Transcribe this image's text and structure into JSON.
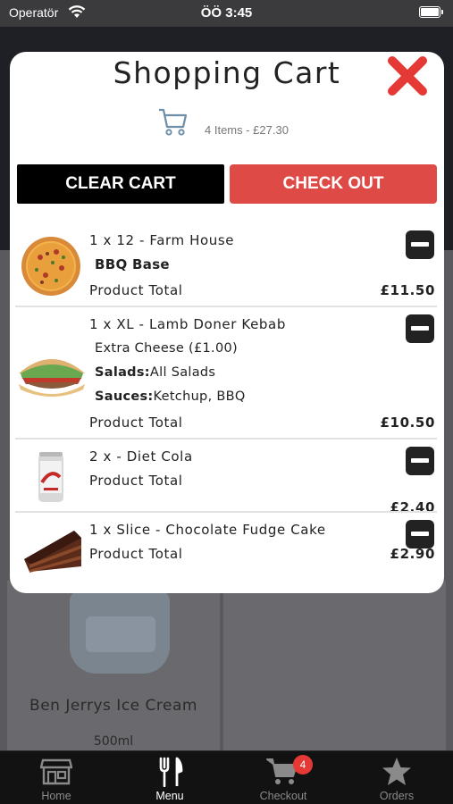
{
  "status_bar": {
    "carrier": "Operatör",
    "time": "ÖÖ 3:45"
  },
  "background": {
    "item_name": "Ben Jerrys Ice Cream",
    "item_size": "500ml"
  },
  "cart": {
    "title": "Shopping Cart",
    "summary": "4 Items - £27.30",
    "clear_label": "CLEAR CART",
    "checkout_label": "CHECK OUT",
    "items": [
      {
        "name": "1 x 12 - Farm House",
        "base": "BBQ Base",
        "total_label": "Product Total",
        "price": "£11.50",
        "image": "pizza"
      },
      {
        "name": "1 x XL - Lamb Doner Kebab",
        "extra": "Extra Cheese (£1.00)",
        "salads_label": "Salads:",
        "salads_value": "All Salads",
        "sauces_label": "Sauces:",
        "sauces_value": "Ketchup, BBQ",
        "total_label": "Product Total",
        "price": "£10.50",
        "image": "kebab"
      },
      {
        "name": "2 x - Diet Cola",
        "total_label": "Product Total",
        "price": "£2.40",
        "image": "diet-cola-can"
      },
      {
        "name": "1 x Slice - Chocolate Fudge Cake",
        "total_label": "Product Total",
        "price": "£2.90",
        "image": "chocolate-cake"
      }
    ]
  },
  "tabs": [
    {
      "label": "Home",
      "icon": "store-icon",
      "active": false
    },
    {
      "label": "Menu",
      "icon": "fork-knife-icon",
      "active": true
    },
    {
      "label": "Checkout",
      "icon": "cart-icon",
      "active": false,
      "badge": "4"
    },
    {
      "label": "Orders",
      "icon": "star-icon",
      "active": false
    }
  ],
  "colors": {
    "checkout_red": "#de4a46",
    "close_red": "#e53935",
    "tab_bar": "#121212"
  }
}
